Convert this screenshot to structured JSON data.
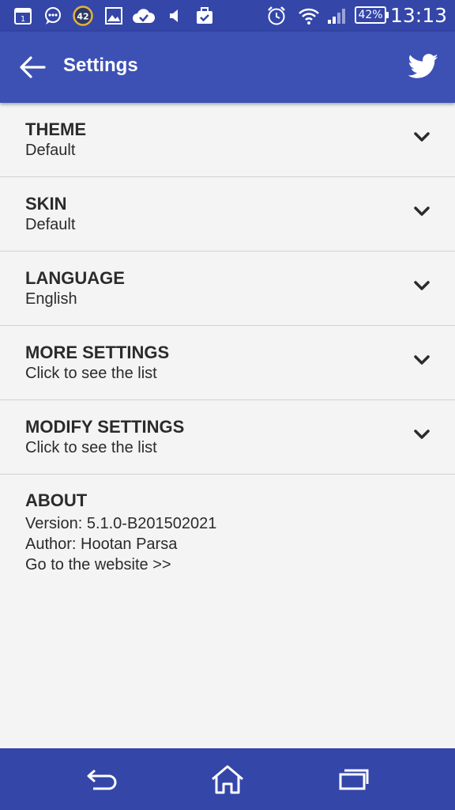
{
  "status_bar": {
    "calendar_day": "1",
    "badge_count": "42",
    "battery": "42%",
    "time": "13:13",
    "icons": [
      "calendar-icon",
      "chat-icon",
      "badge-icon",
      "image-icon",
      "cloud-check-icon",
      "volume-icon",
      "briefcase-icon",
      "alarm-icon",
      "wifi-icon",
      "signal-icon",
      "battery-icon"
    ]
  },
  "app_bar": {
    "title": "Settings",
    "back_icon": "arrow-left-icon",
    "action_icon": "twitter-icon"
  },
  "settings": [
    {
      "title": "THEME",
      "subtitle": "Default"
    },
    {
      "title": "SKIN",
      "subtitle": "Default"
    },
    {
      "title": "LANGUAGE",
      "subtitle": "English"
    },
    {
      "title": "MORE SETTINGS",
      "subtitle": "Click to see the list"
    },
    {
      "title": "MODIFY SETTINGS",
      "subtitle": "Click to see the list"
    }
  ],
  "about": {
    "title": "ABOUT",
    "version": "Version: 5.1.0-B201502021",
    "author": "Author: Hootan Parsa",
    "website": "Go to the website >>"
  },
  "colors": {
    "app_bar": "#3d51b5",
    "status_bar": "#3446a8",
    "background": "#f4f4f4",
    "text": "#2b2b2b"
  },
  "nav_bar": {
    "icons": [
      "back-icon",
      "home-icon",
      "recents-icon"
    ]
  }
}
